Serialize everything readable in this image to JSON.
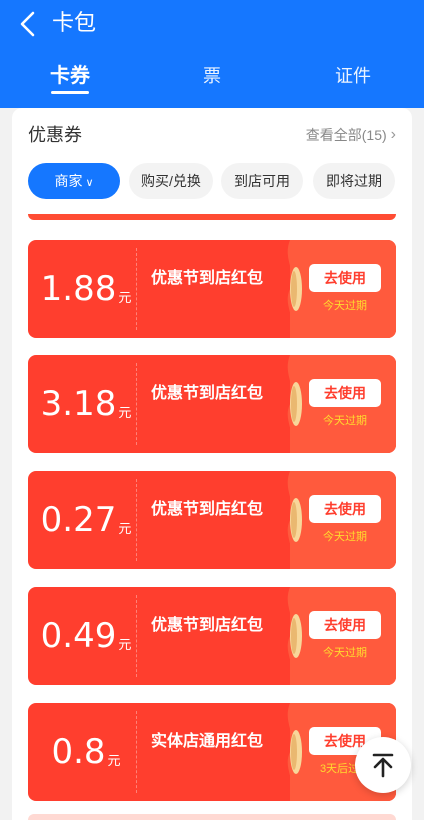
{
  "header": {
    "title": "卡包",
    "tabs": [
      {
        "label": "卡券",
        "active": true
      },
      {
        "label": "票",
        "active": false
      },
      {
        "label": "证件",
        "active": false
      }
    ]
  },
  "section": {
    "title": "优惠券",
    "view_all": "查看全部(15)"
  },
  "filters": [
    {
      "label": "商家",
      "active": true,
      "has_dropdown": true
    },
    {
      "label": "购买/兑换",
      "active": false
    },
    {
      "label": "到店可用",
      "active": false
    },
    {
      "label": "即将过期",
      "active": false
    }
  ],
  "coupons": [
    {
      "amount": "1.88",
      "unit": "元",
      "name": "优惠节到店红包",
      "button": "去使用",
      "expire": "今天过期"
    },
    {
      "amount": "3.18",
      "unit": "元",
      "name": "优惠节到店红包",
      "button": "去使用",
      "expire": "今天过期"
    },
    {
      "amount": "0.27",
      "unit": "元",
      "name": "优惠节到店红包",
      "button": "去使用",
      "expire": "今天过期"
    },
    {
      "amount": "0.49",
      "unit": "元",
      "name": "优惠节到店红包",
      "button": "去使用",
      "expire": "今天过期"
    },
    {
      "amount": "0.8",
      "unit": "元",
      "name": "实体店通用红包",
      "button": "去使用",
      "expire": "3天后过期"
    }
  ],
  "colors": {
    "brand_blue": "#1577ff",
    "coupon_red": "#ff3e2e",
    "expire_yellow": "#ffdb2e"
  },
  "icons": {
    "back": "chevron-left-icon",
    "view_all": "chevron-right-icon",
    "dropdown": "chevron-down-icon",
    "back_to_top": "arrow-up-to-top-icon"
  }
}
